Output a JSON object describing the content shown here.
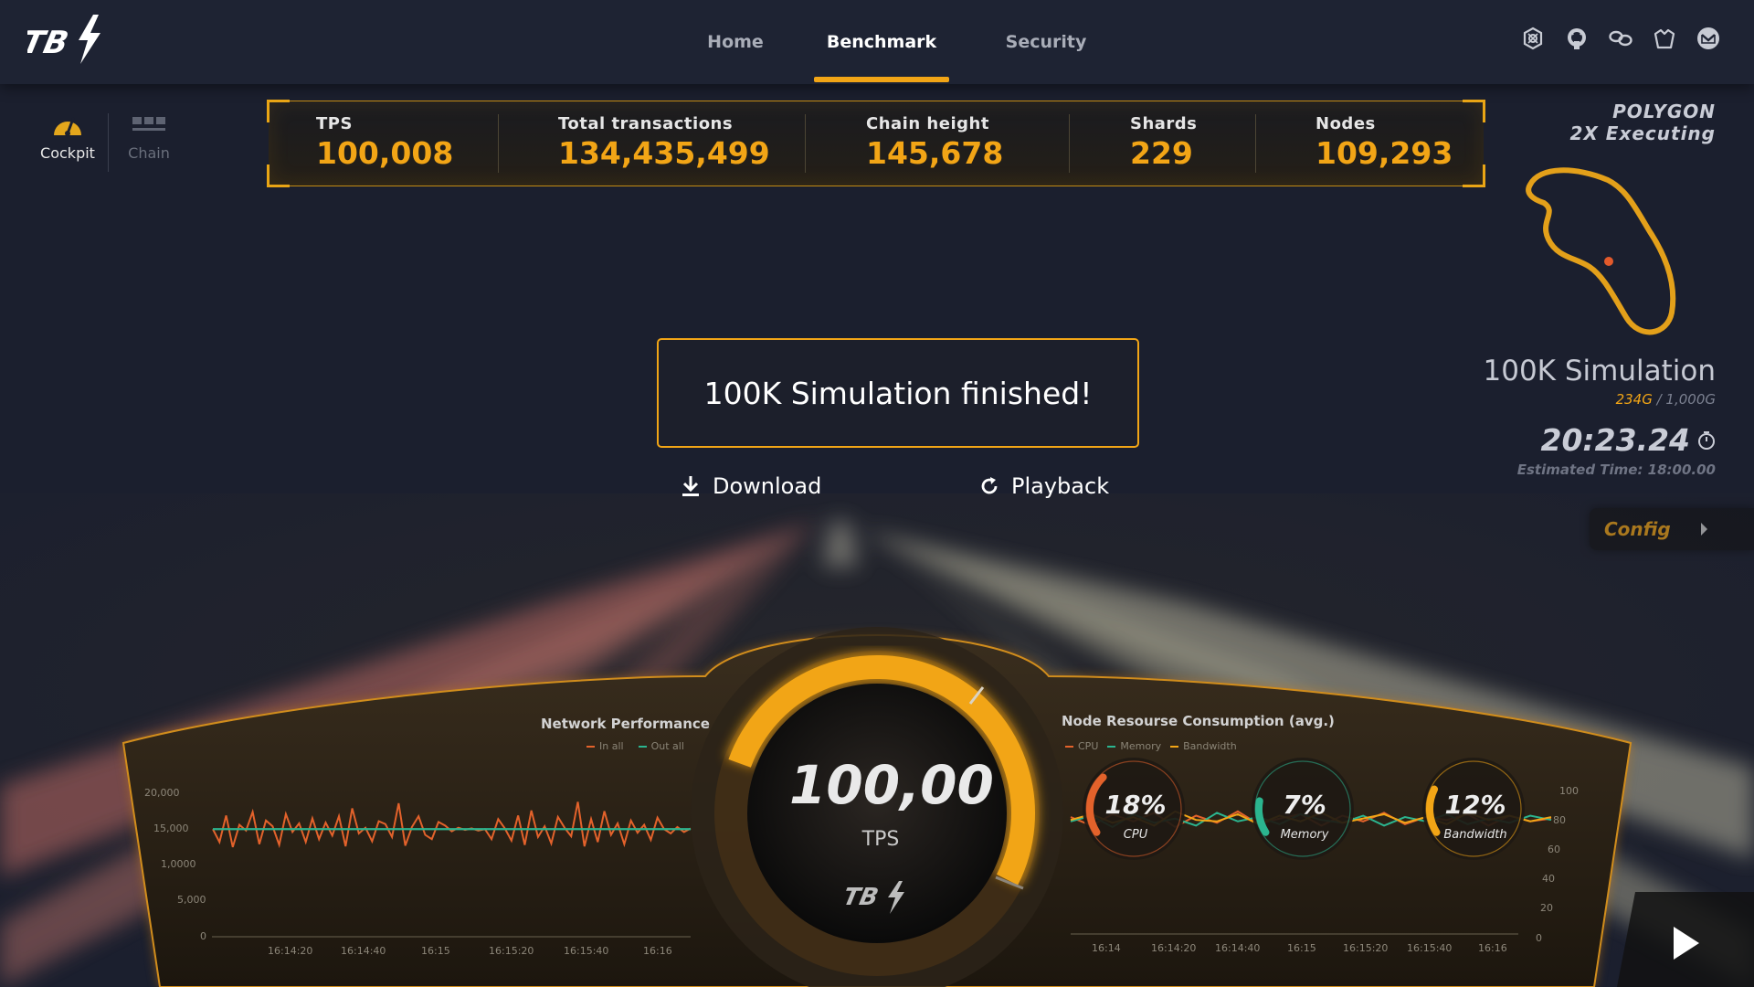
{
  "nav": {
    "items": [
      "Home",
      "Benchmark",
      "Security"
    ],
    "active": "Benchmark"
  },
  "social_icons": [
    "dharma-icon",
    "github-icon",
    "link-icon",
    "crown-icon",
    "mail-icon"
  ],
  "sidebar": {
    "items": [
      {
        "label": "Cockpit",
        "icon": "speedometer-icon",
        "active": true
      },
      {
        "label": "Chain",
        "icon": "chain-blocks-icon",
        "active": false
      }
    ]
  },
  "stats": [
    {
      "label": "TPS",
      "value": "100,008"
    },
    {
      "label": "Total  transactions",
      "value": "134,435,499"
    },
    {
      "label": "Chain height",
      "value": "145,678"
    },
    {
      "label": "Shards",
      "value": "229"
    },
    {
      "label": "Nodes",
      "value": "109,293"
    }
  ],
  "simulation": {
    "network": "POLYGON",
    "mode": "2X Executing",
    "name": "100K Simulation",
    "size_used": "234G",
    "size_sep": " / ",
    "size_total": "1,000G",
    "timer": "20:23.24",
    "estimated": "Estimated Time: 18:00.00",
    "config_label": "Config"
  },
  "dialog": {
    "message": "100K Simulation finished!",
    "download_label": "Download",
    "playback_label": "Playback"
  },
  "tps_gauge": {
    "value": "100,00",
    "label": "TPS",
    "fill": 0.85
  },
  "colors": {
    "accent": "#f2a516",
    "in_all": "#e3622b",
    "out_all": "#2bb58f",
    "cpu": "#e3622b",
    "memory": "#2bb58f",
    "bandwidth": "#f2a516"
  },
  "chart_data": [
    {
      "type": "line",
      "title": "Network Performance",
      "y_ticks": [
        "20,000",
        "15,000",
        "1,0000",
        "5,000",
        "0"
      ],
      "x_ticks": [
        "16:14:20",
        "16:14:40",
        "16:15",
        "16:15:20",
        "16:15:40",
        "16:16"
      ],
      "series": [
        {
          "name": "In all",
          "values": [
            15000,
            13200,
            16900,
            12500,
            15600,
            14800,
            17400,
            12900,
            16200,
            15400,
            12800,
            17100,
            14600,
            15800,
            13200,
            16500,
            13600,
            15900,
            14100,
            16800,
            12600,
            17900,
            14400,
            15200,
            13300,
            16100,
            15700,
            13900,
            18600,
            12700,
            15300,
            16800,
            14200,
            13600,
            16000,
            15500,
            14700,
            15200,
            14900,
            15100,
            14800,
            15000,
            13600,
            16400,
            15100,
            13400,
            16900,
            12800,
            17600,
            13900,
            15400,
            13000,
            16700,
            15200,
            14000,
            18800,
            12600,
            16400,
            13200,
            17500,
            14200,
            15800,
            12900,
            16200,
            14500,
            15600,
            13500,
            16600,
            15000,
            14400,
            15300,
            14600,
            15100
          ]
        },
        {
          "name": "Out all",
          "values": [
            15000,
            15000,
            15000,
            15000,
            15000,
            15000,
            15000,
            15000,
            15000,
            15000,
            15000,
            15000,
            15000,
            15000,
            15000,
            15000,
            15000,
            15000,
            15000,
            15000
          ]
        }
      ]
    },
    {
      "type": "line",
      "title": "Node Resourse Consumption  (avg.)",
      "y_ticks": [
        "100",
        "80",
        "60",
        "40",
        "20",
        "0"
      ],
      "x_ticks": [
        "16:14",
        "16:14:20",
        "16:14:40",
        "16:15",
        "16:15:20",
        "16:15:40",
        "16:16"
      ],
      "series": [
        {
          "name": "CPU",
          "values": [
            82,
            76,
            84,
            79,
            85,
            75,
            83,
            78,
            86,
            77,
            81,
            84,
            76,
            83,
            79,
            85,
            77,
            82,
            80,
            84,
            76,
            83,
            79,
            81
          ]
        },
        {
          "name": "Memory",
          "values": [
            79,
            83,
            75,
            84,
            78,
            81,
            76,
            85,
            79,
            82,
            77,
            84,
            80,
            78,
            83,
            76,
            82,
            79,
            84,
            77,
            81,
            78,
            83,
            80
          ]
        },
        {
          "name": "Bandwidth",
          "values": [
            80,
            84,
            78,
            82,
            76,
            86,
            80,
            79,
            84,
            77,
            83,
            79,
            85,
            78,
            81,
            84,
            78,
            82,
            77,
            85,
            80,
            83,
            79,
            82
          ]
        }
      ],
      "gauges": [
        {
          "label": "CPU",
          "value": "18%",
          "fill": 0.18
        },
        {
          "label": "Memory",
          "value": "7%",
          "fill": 0.07
        },
        {
          "label": "Bandwidth",
          "value": "12%",
          "fill": 0.12
        }
      ]
    }
  ]
}
